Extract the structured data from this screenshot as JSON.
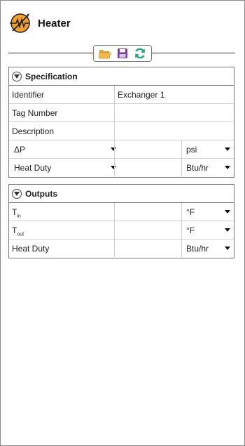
{
  "header": {
    "title": "Heater",
    "icon": "heater-icon"
  },
  "toolbar": {
    "icons": [
      "folder-open-icon",
      "save-icon",
      "refresh-icon"
    ]
  },
  "specification": {
    "title": "Specification",
    "identifier": {
      "label": "Identifier",
      "value": "Exchanger 1"
    },
    "tag_number": {
      "label": "Tag Number",
      "value": ""
    },
    "description": {
      "label": "Description",
      "value": ""
    },
    "dp": {
      "label": "ΔP",
      "value": "",
      "unit": "psi"
    },
    "heat_duty": {
      "label": "Heat Duty",
      "value": "",
      "unit": "Btu/hr"
    }
  },
  "outputs": {
    "title": "Outputs",
    "t_in": {
      "label_main": "T",
      "label_sub": "in",
      "value": "",
      "unit": "°F"
    },
    "t_out": {
      "label_main": "T",
      "label_sub": "out",
      "value": "",
      "unit": "°F"
    },
    "heat_duty": {
      "label": "Heat Duty",
      "value": "",
      "unit": "Btu/hr"
    }
  },
  "colors": {
    "icon_orange": "#f0a030",
    "save_purple": "#7a3aa8",
    "refresh_green": "#2aa87a"
  }
}
